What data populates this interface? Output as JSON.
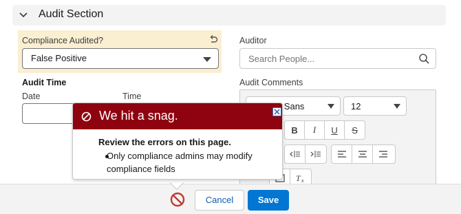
{
  "section": {
    "title": "Audit Section"
  },
  "compliance": {
    "label": "Compliance Audited?",
    "value": "False Positive"
  },
  "auditor": {
    "label": "Auditor",
    "placeholder": "Search People..."
  },
  "audit_time": {
    "label": "Audit Time",
    "date_label": "Date",
    "time_label": "Time"
  },
  "audit_comments": {
    "label": "Audit Comments",
    "font_family_value": "Source Sans",
    "font_size_value": "12"
  },
  "footer": {
    "cancel_label": "Cancel",
    "save_label": "Save"
  },
  "error_popover": {
    "title": "We hit a snag.",
    "body_title": "Review the errors on this page.",
    "messages": [
      "Only compliance admins may modify compliance fields"
    ]
  },
  "colors": {
    "error_header": "#8e030f",
    "primary": "#0176d3",
    "highlight": "#fbefd2"
  }
}
